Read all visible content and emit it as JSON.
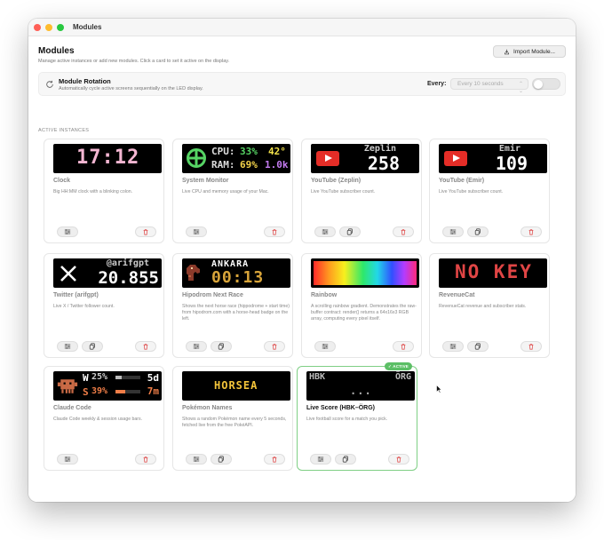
{
  "window": {
    "title": "Modules"
  },
  "header": {
    "title": "Modules",
    "subtitle": "Manage active instances or add new modules. Click a card to set it active on the display.",
    "import_label": "Import Module..."
  },
  "rotation": {
    "title": "Module Rotation",
    "subtitle": "Automatically cycle active screens sequentially on the LED display.",
    "every_label": "Every:",
    "every_value": "Every 10 seconds",
    "enabled": false
  },
  "section_label": "ACTIVE INSTANCES",
  "cards": [
    {
      "name": "Clock",
      "desc": "Big HH:MM clock with a blinking colon.",
      "led": {
        "time": "17:12"
      },
      "copy": false
    },
    {
      "name": "System Monitor",
      "desc": "Live CPU and memory usage of your Mac.",
      "led": {
        "cpu_label": "CPU:",
        "cpu_val": "33%",
        "ram_label": "RAM:",
        "ram_val": "69%",
        "temp": "42°",
        "net": "1.0k"
      },
      "copy": false
    },
    {
      "name": "YouTube (Zeplin)",
      "desc": "Live YouTube subscriber count.",
      "led": {
        "channel": "Zeplin",
        "count": "258"
      },
      "copy": true
    },
    {
      "name": "YouTube (Emir)",
      "desc": "Live YouTube subscriber count.",
      "led": {
        "channel": "Emir",
        "count": "109"
      },
      "copy": true
    },
    {
      "name": "Twitter (arifgpt)",
      "desc": "Live X / Twitter follower count.",
      "led": {
        "handle": "@arifgpt",
        "count": "20.855"
      },
      "copy": true
    },
    {
      "name": "Hipodrom Next Race",
      "desc": "Shows the next horse race (hippodrome + start time) from hipodrom.com with a horse-head badge on the left.",
      "led": {
        "place": "ANKARA",
        "time": "00:13"
      },
      "copy": true
    },
    {
      "name": "Rainbow",
      "desc": "A scrolling rainbow gradient. Demonstrates the raw-buffer contract: render() returns a 64x16x3 RGB array, computing every pixel itself.",
      "led": {},
      "copy": false
    },
    {
      "name": "RevenueCat",
      "desc": "RevenueCat revenue and subscriber stats.",
      "led": {
        "text": "NO KEY"
      },
      "copy": true
    },
    {
      "name": "Claude Code",
      "desc": "Claude Code weekly & session usage bars.",
      "led": {
        "w_label": "W",
        "w_val": "25%",
        "s_label": "S",
        "s_val": "39%",
        "w_time": "5d",
        "s_time": "7m"
      },
      "copy": false
    },
    {
      "name": "Pokémon Names",
      "desc": "Shows a random Pokémon name every 5 seconds, fetched live from the free PokéAPI.",
      "led": {
        "text": "HORSEA"
      },
      "copy": true
    },
    {
      "name": "Live Score (HBK–ÖRG)",
      "desc": "Live football score for a match you pick.",
      "led": {
        "home": "HBK",
        "away": "ÖRG",
        "score": "..."
      },
      "copy": true,
      "active": true,
      "badge": "✓ ACTIVE"
    }
  ],
  "colors": {
    "close": "#ff5f57",
    "minimize": "#febc2e",
    "zoom": "#28c840",
    "clock_pink": "#f4b6d2",
    "cpu_green": "#56d464",
    "cpu_yellow": "#f3d34a",
    "temp_yellow": "#f3e24a",
    "net_purple": "#c37bf0",
    "youtube_red": "#e52d27",
    "hipodrom_amber": "#d9a53a",
    "nokey_red": "#e04545",
    "claude_orange": "#f07e48",
    "active_green": "#5cbf66"
  }
}
